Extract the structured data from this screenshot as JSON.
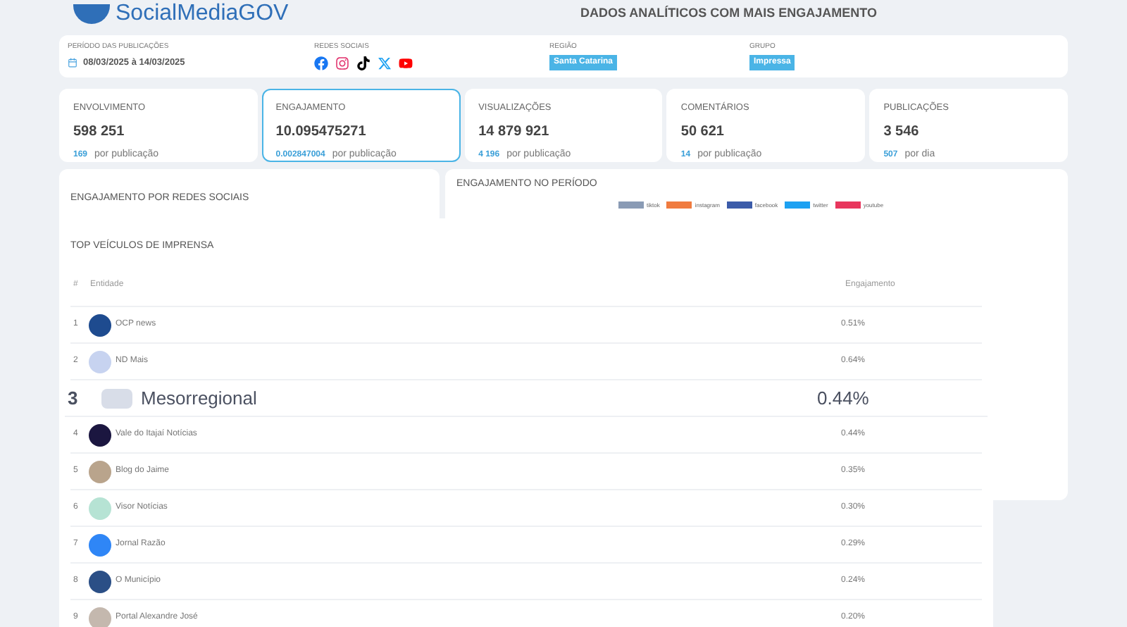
{
  "header": {
    "logo_text": "SocialMediaGOV",
    "title": "DADOS ANALÍTICOS COM MAIS ENGAJAMENTO"
  },
  "filters": {
    "period": {
      "label": "PERÍODO DAS PUBLICAÇÕES",
      "value": "08/03/2025 à 14/03/2025"
    },
    "networks": {
      "label": "REDES SOCIAIS",
      "items": [
        {
          "kind": "facebook"
        },
        {
          "kind": "instagram"
        },
        {
          "kind": "tiktok"
        },
        {
          "kind": "x"
        },
        {
          "kind": "youtube"
        }
      ]
    },
    "region": {
      "label": "REGIÃO",
      "value": "Santa Catarina"
    },
    "group": {
      "label": "GRUPO",
      "value": "Impressa"
    }
  },
  "stats": [
    {
      "label": "ENVOLVIMENTO",
      "value": "598 251",
      "sub_value": "169",
      "sub_label": "por publicação",
      "selected": false
    },
    {
      "label": "ENGAJAMENTO",
      "value": "10.095475271",
      "sub_value": "0.002847004",
      "sub_label": "por publicação",
      "selected": true
    },
    {
      "label": "VISUALIZAÇÕES",
      "value": "14 879 921",
      "sub_value": "4 196",
      "sub_label": "por publicação",
      "selected": false
    },
    {
      "label": "COMENTÁRIOS",
      "value": "50 621",
      "sub_value": "14",
      "sub_label": "por publicação",
      "selected": false
    },
    {
      "label": "PUBLICAÇÕES",
      "value": "3 546",
      "sub_value": "507",
      "sub_label": "por dia",
      "selected": false
    }
  ],
  "panels": {
    "networks_title": "ENGAJAMENTO POR REDES SOCIAIS",
    "period_title": "ENGAJAMENTO NO PERÍODO",
    "legend": [
      {
        "label": "tiktok",
        "color": "#8a9bb5"
      },
      {
        "label": "instagram",
        "color": "#f07b3f"
      },
      {
        "label": "facebook",
        "color": "#3b5ba9"
      },
      {
        "label": "twitter",
        "color": "#1da1f2"
      },
      {
        "label": "youtube",
        "color": "#e8365d"
      }
    ]
  },
  "table": {
    "title": "TOP VEÍCULOS DE IMPRENSA",
    "columns": [
      "#",
      "Entidade",
      "Engajamento"
    ],
    "rows": [
      {
        "rank": "1",
        "name": "OCP news",
        "value": "0.51%",
        "highlighted": false
      },
      {
        "rank": "2",
        "name": "ND Mais",
        "value": "0.64%",
        "highlighted": false
      },
      {
        "rank": "3",
        "name": "Mesorregional",
        "value": "0.44%",
        "highlighted": true
      },
      {
        "rank": "4",
        "name": "Vale do Itajaí Notícias",
        "value": "0.44%",
        "highlighted": false
      },
      {
        "rank": "5",
        "name": "Blog do Jaime",
        "value": "0.35%",
        "highlighted": false
      },
      {
        "rank": "6",
        "name": "Visor Notícias",
        "value": "0.30%",
        "highlighted": false
      },
      {
        "rank": "7",
        "name": "Jornal Razão",
        "value": "0.29%",
        "highlighted": false
      },
      {
        "rank": "8",
        "name": "O Município",
        "value": "0.24%",
        "highlighted": false
      },
      {
        "rank": "9",
        "name": "Portal Alexandre José",
        "value": "0.20%",
        "highlighted": false
      }
    ]
  }
}
